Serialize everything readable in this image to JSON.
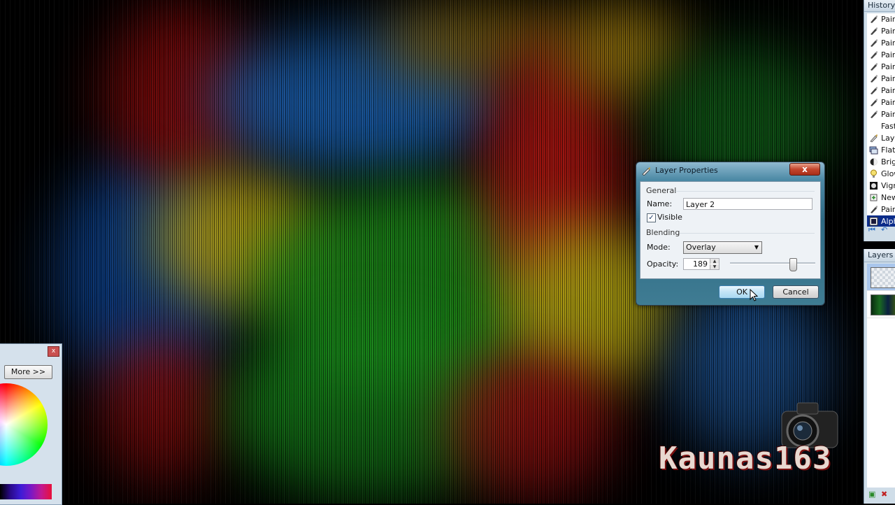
{
  "history": {
    "title": "History",
    "items": [
      {
        "label": "Paint",
        "icon": "paintbrush-icon"
      },
      {
        "label": "Paint",
        "icon": "paintbrush-icon"
      },
      {
        "label": "Paint",
        "icon": "paintbrush-icon"
      },
      {
        "label": "Paint",
        "icon": "paintbrush-icon"
      },
      {
        "label": "Paint",
        "icon": "paintbrush-icon"
      },
      {
        "label": "Paint",
        "icon": "paintbrush-icon"
      },
      {
        "label": "Paint",
        "icon": "paintbrush-icon"
      },
      {
        "label": "Paint",
        "icon": "paintbrush-icon"
      },
      {
        "label": "Paint",
        "icon": "paintbrush-icon"
      },
      {
        "label": "Fast",
        "icon": "blank-icon"
      },
      {
        "label": "Laye",
        "icon": "layer-properties-icon"
      },
      {
        "label": "Flatt",
        "icon": "flatten-icon"
      },
      {
        "label": "Brigh",
        "icon": "brightness-icon"
      },
      {
        "label": "Glow",
        "icon": "glow-icon"
      },
      {
        "label": "Vigne",
        "icon": "vignette-icon"
      },
      {
        "label": "New",
        "icon": "new-layer-icon"
      },
      {
        "label": "Paint",
        "icon": "paintbrush-icon"
      },
      {
        "label": "Alpha",
        "icon": "alpha-icon"
      }
    ],
    "selected_index": 17
  },
  "layers": {
    "title": "Layers"
  },
  "colors": {
    "more_label": "More >>",
    "close_label": "x"
  },
  "dialog": {
    "title": "Layer Properties",
    "close_label": "x",
    "general_label": "General",
    "name_label": "Name:",
    "name_value": "Layer 2",
    "visible_label": "Visible",
    "visible_checked": "✓",
    "blending_label": "Blending",
    "mode_label": "Mode:",
    "mode_value": "Overlay",
    "opacity_label": "Opacity:",
    "opacity_value": "189",
    "opacity_fraction": 0.741,
    "ok_label": "OK",
    "cancel_label": "Cancel"
  },
  "watermark": {
    "text": "Kaunas163"
  },
  "colors_theme": {
    "dialog_frame": "#2e6a84",
    "selected_history": "#0b2c8a"
  }
}
